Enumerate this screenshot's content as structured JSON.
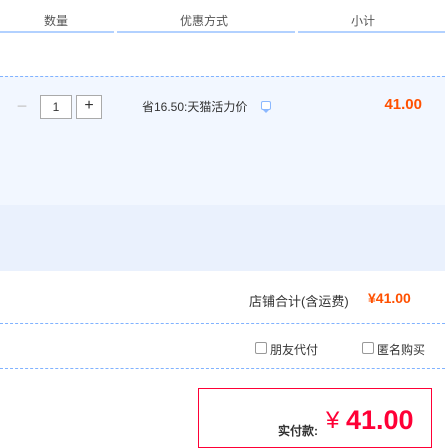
{
  "header": {
    "quantity_label": "数量",
    "discount_label": "优惠方式",
    "subtotal_label": "小计"
  },
  "item": {
    "quantity_minus": "−",
    "quantity": "1",
    "quantity_plus": "+",
    "promotion": "省16.50:天猫活力价",
    "subtotal": "41.00"
  },
  "shop": {
    "total_label": "店铺合计(含运费)",
    "total_value": "¥41.00"
  },
  "options": [
    {
      "label": "朋友代付"
    },
    {
      "label": "匿名购买"
    }
  ],
  "payment": {
    "label": "实付款:",
    "currency": "¥",
    "amount": "41.00"
  },
  "colors": {
    "accent": "#ff5000",
    "pay_red": "#ff0036",
    "header_line": "#b2d1ff",
    "item_bg": "#f2f7ff"
  }
}
